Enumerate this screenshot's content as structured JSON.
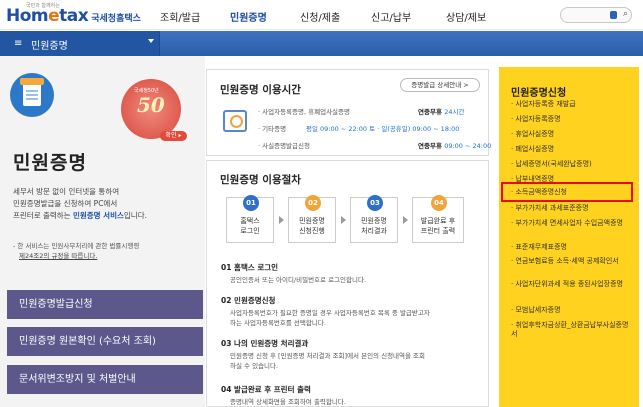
{
  "brand": {
    "logo_small": "국민과 함께하는",
    "logo_main_pre": "Hom",
    "logo_main_e": "e",
    "logo_main_post": "tax",
    "logo_sub": "국세청홈택스"
  },
  "top_menu": [
    "조회/발급",
    "민원증명",
    "신청/제출",
    "신고/납부",
    "상담/제보"
  ],
  "search": {
    "icon": "search-icon",
    "dropdown_icon": "chevron-down-icon"
  },
  "bar": {
    "title": "민원증명"
  },
  "left": {
    "title": "민원증명",
    "badge_text": "국세청50년",
    "badge_number": "50",
    "badge_button": "확인 ▸",
    "desc_line1": "세무서 방문 없이 인터넷을 통하여",
    "desc_line2": "민원증명발급을 신청하여 PC에서",
    "desc_line3a": "프린터로 출력하는 ",
    "desc_line3b": "민원증명 서비스",
    "desc_line3c": "입니다.",
    "note_line1": "- 한 서비스는 민원사무처리에 관한 법률시행령",
    "note_line2": "제24조2의 규정을 따릅니다.",
    "buttons": [
      "민원증명발급신청",
      "민원증명 원본확인 (수요처 조회)",
      "문서위변조방지 및 처벌안내"
    ]
  },
  "hours": {
    "title": "민원증명 이용시간",
    "detail_button": "증명발급 상세안내 >",
    "rows": [
      {
        "label": "· 사업자등록증명, 휴폐업사실증명",
        "value_pre": "연중무휴 ",
        "value_hl": "24시간"
      },
      {
        "label": "· 기타증명",
        "value_mid": "평일 09:00 ~ 22:00  토 · 일(공휴일) 09:00 ~ 18:00"
      },
      {
        "label": "· 사실증명발급신청",
        "value_pre": "연중무휴 ",
        "value_hl": "09:00 ~ 24:00"
      }
    ]
  },
  "procedure": {
    "title": "민원증명 이용절차",
    "steps": [
      {
        "num": "01",
        "line1": "홈택스",
        "line2": "로그인",
        "color": "#2f6fc6"
      },
      {
        "num": "02",
        "line1": "민원증명",
        "line2": "신청진행",
        "color": "#f2a33a"
      },
      {
        "num": "03",
        "line1": "민원증명",
        "line2": "처리결과",
        "color": "#2f6fc6"
      },
      {
        "num": "04",
        "line1": "발급완료 후",
        "line2": "프린터 출력",
        "color": "#f2a33a"
      }
    ],
    "sections": [
      {
        "head": "01 홈택스 로그인",
        "body": [
          "공인인증서 또는 아이디/비밀번호로 로그인합니다."
        ]
      },
      {
        "head": "02 민원증명신청",
        "body": [
          "사업자등록번호가 필요한 증명일 경우 사업자등록번호 목록 중 발급받고자",
          "하는 사업자등록번호를 선택합니다."
        ]
      },
      {
        "head": "03 나의 민원증명 처리결과",
        "body": [
          "민원증명 신청 후 [민원증명 처리결과 조회]에서 본인의 신청내역을 조회",
          "하실 수 있습니다."
        ]
      },
      {
        "head": "04 발급완료 후 프린터 출력",
        "body": [
          "증명내역 상세화면을 조회하여 출력합니다."
        ]
      }
    ]
  },
  "right": {
    "title": "민원증명신청",
    "items": [
      "사업자등록증 재발급",
      "사업자등록증명",
      "휴업사실증명",
      "폐업사실증명",
      "납세증명서(국세완납증명)",
      "납부내역증명",
      "소득금액증명신청",
      "부가가치세 과세표준증명",
      "부가가치세 면세사업자 수입금액증명",
      "표준재무제표증명",
      "연금보험료등 소득·세액 공제확인서",
      "사업자단위과세 적용 종된사업장증명",
      "모범납세자증명",
      "취업후학자금상환_상환금납부사실증명서"
    ]
  },
  "colors": {
    "nav_blue": "#2a5ea9",
    "left_button": "#5c588c",
    "right_panel": "#ffd21f",
    "highlight": "#e20d0d"
  }
}
